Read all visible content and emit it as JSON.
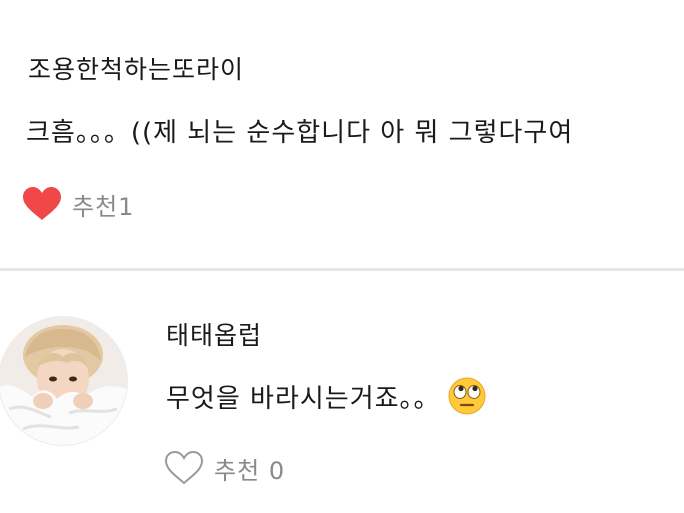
{
  "comments": [
    {
      "author": "조용한척하는또라이",
      "text": "크흠。。。((제 뇌는 순수합니다 아 뭐 그렇다구여",
      "like_label": "추천",
      "like_count": "1",
      "liked": true,
      "heart_color": "#f04848"
    },
    {
      "author": "태태옵럽",
      "text": "무엇을 바라시는거죠。。",
      "emoji": "face-with-rolling-eyes",
      "like_label": "추천",
      "like_count": "0",
      "liked": false,
      "heart_color": "#9a9a9a"
    }
  ],
  "colors": {
    "divider": "#e5e5e5",
    "meta_text": "#8a8a8a"
  }
}
